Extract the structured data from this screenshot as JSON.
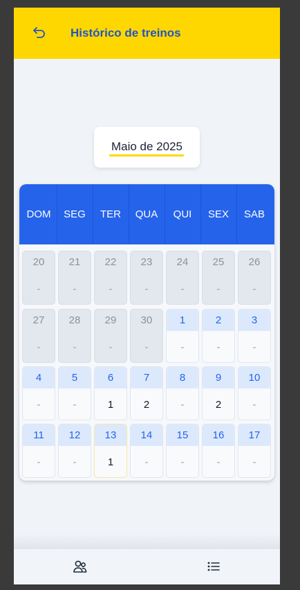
{
  "header": {
    "title": "Histórico de treinos",
    "back_icon": "undo-arrow-icon",
    "background": "#ffd700",
    "title_color": "#2255c6"
  },
  "month": {
    "label": "Maio de 2025",
    "underline_color": "#ffd700"
  },
  "calendar": {
    "header_color": "#2563eb",
    "weekdays": [
      "DOM",
      "SEG",
      "TER",
      "QUA",
      "QUI",
      "SEX",
      "SAB"
    ],
    "weeks": [
      [
        {
          "day": "20",
          "value": "-",
          "current": false
        },
        {
          "day": "21",
          "value": "-",
          "current": false
        },
        {
          "day": "22",
          "value": "-",
          "current": false
        },
        {
          "day": "23",
          "value": "-",
          "current": false
        },
        {
          "day": "24",
          "value": "-",
          "current": false
        },
        {
          "day": "25",
          "value": "-",
          "current": false
        },
        {
          "day": "26",
          "value": "-",
          "current": false
        }
      ],
      [
        {
          "day": "27",
          "value": "-",
          "current": false
        },
        {
          "day": "28",
          "value": "-",
          "current": false
        },
        {
          "day": "29",
          "value": "-",
          "current": false
        },
        {
          "day": "30",
          "value": "-",
          "current": false
        },
        {
          "day": "1",
          "value": "-",
          "current": true
        },
        {
          "day": "2",
          "value": "-",
          "current": true
        },
        {
          "day": "3",
          "value": "-",
          "current": true
        }
      ],
      [
        {
          "day": "4",
          "value": "-",
          "current": true
        },
        {
          "day": "5",
          "value": "-",
          "current": true
        },
        {
          "day": "6",
          "value": "1",
          "current": true
        },
        {
          "day": "7",
          "value": "2",
          "current": true
        },
        {
          "day": "8",
          "value": "-",
          "current": true
        },
        {
          "day": "9",
          "value": "2",
          "current": true
        },
        {
          "day": "10",
          "value": "-",
          "current": true
        }
      ],
      [
        {
          "day": "11",
          "value": "-",
          "current": true
        },
        {
          "day": "12",
          "value": "-",
          "current": true
        },
        {
          "day": "13",
          "value": "1",
          "current": true,
          "today": true
        },
        {
          "day": "14",
          "value": "-",
          "current": true
        },
        {
          "day": "15",
          "value": "-",
          "current": true
        },
        {
          "day": "16",
          "value": "-",
          "current": true
        },
        {
          "day": "17",
          "value": "-",
          "current": true
        }
      ]
    ]
  },
  "tabbar": {
    "tabs": [
      {
        "icon": "users-icon"
      },
      {
        "icon": "list-icon"
      }
    ]
  }
}
